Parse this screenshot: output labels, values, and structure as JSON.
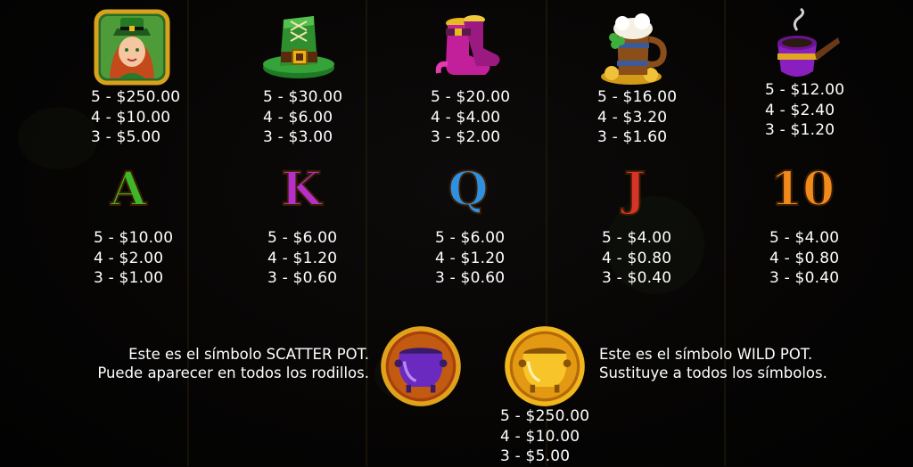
{
  "symbols": [
    {
      "id": "leprechaun-girl",
      "icon": "leprechaun-girl-icon",
      "pays": [
        "5 - $250.00",
        "4 - $10.00",
        "3 - $5.00"
      ]
    },
    {
      "id": "green-hat",
      "icon": "green-hat-icon",
      "pays": [
        "5 - $30.00",
        "4 - $6.00",
        "3 - $3.00"
      ]
    },
    {
      "id": "boots",
      "icon": "pink-boots-icon",
      "pays": [
        "5 - $20.00",
        "4 - $4.00",
        "3 - $2.00"
      ]
    },
    {
      "id": "beer-mug",
      "icon": "beer-mug-icon",
      "pays": [
        "5 - $16.00",
        "4 - $3.20",
        "3 - $1.60"
      ]
    },
    {
      "id": "pipe",
      "icon": "pipe-icon",
      "pays": [
        "5 - $12.00",
        "4 - $2.40",
        "3 - $1.20"
      ]
    },
    {
      "id": "A",
      "icon": "letter-a-icon",
      "glyph": "A",
      "color": "#3fb52a",
      "pays": [
        "5 - $10.00",
        "4 - $2.00",
        "3 - $1.00"
      ]
    },
    {
      "id": "K",
      "icon": "letter-k-icon",
      "glyph": "K",
      "color": "#b72fc9",
      "pays": [
        "5 - $6.00",
        "4 - $1.20",
        "3 - $0.60"
      ]
    },
    {
      "id": "Q",
      "icon": "letter-q-icon",
      "glyph": "Q",
      "color": "#2f8fe0",
      "pays": [
        "5 - $6.00",
        "4 - $1.20",
        "3 - $0.60"
      ]
    },
    {
      "id": "J",
      "icon": "letter-j-icon",
      "glyph": "J",
      "color": "#d8332a",
      "pays": [
        "5 - $4.00",
        "4 - $0.80",
        "3 - $0.40"
      ]
    },
    {
      "id": "10",
      "icon": "number-10-icon",
      "glyph": "10",
      "color": "#f08a1c",
      "pays": [
        "5 - $4.00",
        "4 - $0.80",
        "3 - $0.40"
      ]
    }
  ],
  "scatter": {
    "icon": "purple-pot-icon",
    "line1": "Este es el símbolo SCATTER POT.",
    "line2": "Puede aparecer en todos los rodillos."
  },
  "wild": {
    "icon": "gold-pot-icon",
    "line1": "Este es el símbolo WILD POT.",
    "line2": "Sustituye a todos los símbolos.",
    "pays": [
      "5 - $250.00",
      "4 - $10.00",
      "3 - $5.00"
    ]
  }
}
